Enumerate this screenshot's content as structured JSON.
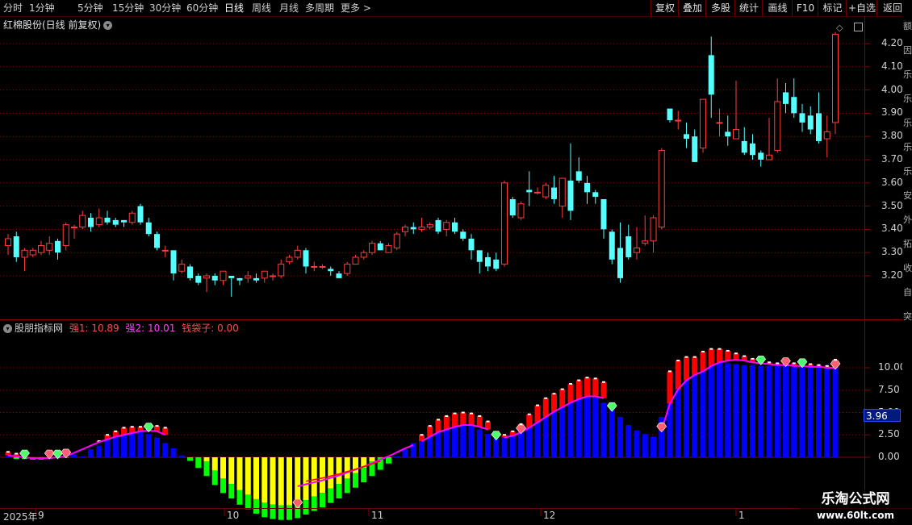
{
  "topbar": {
    "periods": [
      "分时",
      "1分钟",
      "5分钟",
      "15分钟",
      "30分钟",
      "60分钟",
      "日线",
      "周线",
      "月线",
      "多周期",
      "更多 >"
    ],
    "active_index": 6,
    "right_buttons": [
      "复权",
      "叠加",
      "多股",
      "统计",
      "画线",
      "F10",
      "标记",
      "+自选",
      "返回"
    ]
  },
  "main_panel": {
    "stock_title": "红棉股份(日线 前复权)",
    "y_ticks": [
      "4.20",
      "4.10",
      "4.00",
      "3.90",
      "3.80",
      "3.70",
      "3.60",
      "3.50",
      "3.40",
      "3.30",
      "3.20"
    ]
  },
  "indicator_panel": {
    "name": "股朋指标网",
    "line1_label": "强1: 10.89",
    "line2_label": "强2: 10.01",
    "line3_label": "钱袋子: 0.00",
    "y_ticks": [
      "10.00",
      "7.50",
      "5.00",
      "2.50",
      "0.00"
    ],
    "current_value": "3.96"
  },
  "x_axis": {
    "labels": [
      "2025年",
      "9",
      "10",
      "11",
      "12",
      "1"
    ]
  },
  "side_strip": [
    "额",
    "因",
    "乐",
    "乐",
    "乐",
    "乐",
    "乐",
    "安",
    "外",
    "拓",
    "收",
    "自",
    "突"
  ],
  "watermark": {
    "title": "乐淘公式网",
    "url": "www.60lt.com"
  },
  "colors": {
    "up": "#ff3c3c",
    "down": "#54ffff",
    "bar_blue": "#0000ff",
    "bar_red": "#ff0000",
    "bar_yellow": "#ffff00",
    "bar_green": "#00ff00",
    "line_magenta": "#ff00ff"
  },
  "chart_data": [
    {
      "type": "candlestick",
      "title": "红棉股份(日线 前复权)",
      "ylim": [
        3.1,
        4.25
      ],
      "candles": [
        [
          3.33,
          3.36,
          3.29,
          3.38
        ],
        [
          3.37,
          3.28,
          3.26,
          3.39
        ],
        [
          3.28,
          3.31,
          3.22,
          3.32
        ],
        [
          3.29,
          3.31,
          3.28,
          3.32
        ],
        [
          3.3,
          3.33,
          3.29,
          3.35
        ],
        [
          3.31,
          3.34,
          3.29,
          3.37
        ],
        [
          3.35,
          3.3,
          3.27,
          3.36
        ],
        [
          3.33,
          3.42,
          3.31,
          3.43
        ],
        [
          3.41,
          3.41,
          3.36,
          3.42
        ],
        [
          3.41,
          3.46,
          3.4,
          3.48
        ],
        [
          3.45,
          3.41,
          3.39,
          3.47
        ],
        [
          3.42,
          3.45,
          3.41,
          3.49
        ],
        [
          3.45,
          3.43,
          3.42,
          3.48
        ],
        [
          3.44,
          3.42,
          3.41,
          3.45
        ],
        [
          3.44,
          3.43,
          3.41,
          3.44
        ],
        [
          3.43,
          3.47,
          3.42,
          3.48
        ],
        [
          3.5,
          3.43,
          3.42,
          3.51
        ],
        [
          3.43,
          3.38,
          3.37,
          3.45
        ],
        [
          3.38,
          3.32,
          3.31,
          3.39
        ],
        [
          3.31,
          3.31,
          3.28,
          3.33
        ],
        [
          3.31,
          3.21,
          3.18,
          3.31
        ],
        [
          3.22,
          3.25,
          3.21,
          3.27
        ],
        [
          3.24,
          3.19,
          3.18,
          3.25
        ],
        [
          3.2,
          3.17,
          3.16,
          3.21
        ],
        [
          3.19,
          3.2,
          3.13,
          3.21
        ],
        [
          3.2,
          3.18,
          3.16,
          3.21
        ],
        [
          3.18,
          3.22,
          3.16,
          3.22
        ],
        [
          3.2,
          3.19,
          3.11,
          3.2
        ],
        [
          3.19,
          3.18,
          3.16,
          3.19
        ],
        [
          3.19,
          3.2,
          3.17,
          3.22
        ],
        [
          3.19,
          3.18,
          3.17,
          3.21
        ],
        [
          3.19,
          3.22,
          3.17,
          3.22
        ],
        [
          3.2,
          3.2,
          3.18,
          3.21
        ],
        [
          3.2,
          3.25,
          3.19,
          3.27
        ],
        [
          3.26,
          3.28,
          3.25,
          3.29
        ],
        [
          3.28,
          3.31,
          3.27,
          3.33
        ],
        [
          3.31,
          3.24,
          3.21,
          3.32
        ],
        [
          3.24,
          3.24,
          3.22,
          3.26
        ],
        [
          3.24,
          3.24,
          3.23,
          3.25
        ],
        [
          3.23,
          3.22,
          3.2,
          3.24
        ],
        [
          3.21,
          3.19,
          3.19,
          3.22
        ],
        [
          3.21,
          3.25,
          3.2,
          3.26
        ],
        [
          3.25,
          3.28,
          3.25,
          3.29
        ],
        [
          3.28,
          3.3,
          3.27,
          3.31
        ],
        [
          3.3,
          3.34,
          3.29,
          3.35
        ],
        [
          3.34,
          3.31,
          3.31,
          3.35
        ],
        [
          3.3,
          3.33,
          3.3,
          3.34
        ],
        [
          3.32,
          3.38,
          3.31,
          3.39
        ],
        [
          3.39,
          3.41,
          3.37,
          3.42
        ],
        [
          3.41,
          3.4,
          3.38,
          3.43
        ],
        [
          3.4,
          3.41,
          3.39,
          3.45
        ],
        [
          3.41,
          3.42,
          3.4,
          3.43
        ],
        [
          3.44,
          3.39,
          3.38,
          3.45
        ],
        [
          3.4,
          3.43,
          3.37,
          3.44
        ],
        [
          3.43,
          3.39,
          3.38,
          3.45
        ],
        [
          3.39,
          3.36,
          3.35,
          3.4
        ],
        [
          3.36,
          3.31,
          3.27,
          3.38
        ],
        [
          3.31,
          3.26,
          3.21,
          3.31
        ],
        [
          3.28,
          3.24,
          3.22,
          3.3
        ],
        [
          3.27,
          3.23,
          3.22,
          3.3
        ],
        [
          3.25,
          3.6,
          3.24,
          3.61
        ],
        [
          3.53,
          3.46,
          3.45,
          3.54
        ],
        [
          3.45,
          3.51,
          3.44,
          3.52
        ],
        [
          3.57,
          3.56,
          3.5,
          3.65
        ],
        [
          3.56,
          3.56,
          3.55,
          3.58
        ],
        [
          3.54,
          3.59,
          3.53,
          3.6
        ],
        [
          3.58,
          3.53,
          3.51,
          3.63
        ],
        [
          3.5,
          3.62,
          3.45,
          3.62
        ],
        [
          3.61,
          3.48,
          3.44,
          3.77
        ],
        [
          3.65,
          3.61,
          3.6,
          3.71
        ],
        [
          3.6,
          3.56,
          3.51,
          3.63
        ],
        [
          3.56,
          3.54,
          3.51,
          3.57
        ],
        [
          3.53,
          3.4,
          3.36,
          3.53
        ],
        [
          3.39,
          3.27,
          3.25,
          3.4
        ],
        [
          3.32,
          3.19,
          3.17,
          3.43
        ],
        [
          3.37,
          3.28,
          3.27,
          3.42
        ],
        [
          3.3,
          3.32,
          3.27,
          3.41
        ],
        [
          3.34,
          3.35,
          3.33,
          3.46
        ],
        [
          3.35,
          3.45,
          3.3,
          3.46
        ],
        [
          3.41,
          3.74,
          3.4,
          3.75
        ],
        [
          3.92,
          3.87,
          3.86,
          3.92
        ],
        [
          3.87,
          3.87,
          3.83,
          3.91
        ],
        [
          3.81,
          3.79,
          3.75,
          3.86
        ],
        [
          3.8,
          3.69,
          3.69,
          3.83
        ],
        [
          3.75,
          3.96,
          3.73,
          3.96
        ],
        [
          4.15,
          3.98,
          3.88,
          4.23
        ],
        [
          3.86,
          3.86,
          3.8,
          3.92
        ],
        [
          3.82,
          3.8,
          3.76,
          3.89
        ],
        [
          3.79,
          3.83,
          3.79,
          4.04
        ],
        [
          3.78,
          3.73,
          3.72,
          3.84
        ],
        [
          3.77,
          3.72,
          3.7,
          3.81
        ],
        [
          3.73,
          3.7,
          3.67,
          3.74
        ],
        [
          3.7,
          3.72,
          3.7,
          3.88
        ],
        [
          3.74,
          3.95,
          3.73,
          4.05
        ],
        [
          3.99,
          3.94,
          3.9,
          4.03
        ],
        [
          3.97,
          3.9,
          3.88,
          4.05
        ],
        [
          3.9,
          3.86,
          3.82,
          3.94
        ],
        [
          3.89,
          3.83,
          3.81,
          3.93
        ],
        [
          3.9,
          3.78,
          3.77,
          3.99
        ],
        [
          3.79,
          3.82,
          3.71,
          3.89
        ],
        [
          3.86,
          4.24,
          3.81,
          4.25
        ]
      ]
    },
    {
      "type": "bar",
      "title": "股朋指标网",
      "ylim": [
        -1.5,
        12.5
      ],
      "bars": [
        0.1,
        -0.2,
        -0.2,
        -0.25,
        -0.25,
        -0.2,
        -0.1,
        -0.05,
        0.3,
        0.1,
        0.9,
        1.3,
        1.9,
        2.3,
        2.6,
        2.8,
        2.9,
        2.6,
        2.2,
        1.6,
        1.0,
        0.2,
        -0.4,
        -1.2,
        -2.1,
        -3.1,
        -4.0,
        -4.6,
        -5.3,
        -5.8,
        -6.3,
        -6.7,
        -6.9,
        -7.0,
        -7.0,
        -6.8,
        -6.4,
        -6.0,
        -5.6,
        -5.1,
        -4.6,
        -4.0,
        -3.4,
        -2.8,
        -2.1,
        -1.4,
        -0.7,
        0.1,
        0.9,
        1.6,
        2.3,
        2.9,
        3.3,
        3.6,
        3.9,
        3.9,
        3.6,
        3.1,
        2.6,
        2.1,
        2.2,
        2.5,
        2.8,
        3.4,
        4.2,
        4.9,
        5.4,
        5.9,
        6.4,
        6.7,
        6.8,
        6.7,
        6.1,
        5.3,
        4.5,
        3.6,
        3.0,
        2.6,
        2.3,
        4.5,
        8.2,
        9.6,
        10.2,
        10.4,
        10.6,
        10.7,
        10.6,
        10.5,
        10.4,
        10.3,
        10.3,
        10.2,
        10.2,
        10.2,
        10.3,
        10.3,
        10.3,
        10.2,
        10.1,
        10.0,
        10.0
      ],
      "strong1": [
        0.6,
        0.4,
        0.2,
        0.0,
        0.0,
        0.0,
        0.0,
        0.0,
        0.0,
        0.0,
        1.2,
        1.8,
        2.5,
        2.9,
        3.3,
        3.4,
        3.4,
        3.5,
        3.5,
        3.3,
        0,
        0,
        0,
        0,
        0,
        0,
        0,
        0,
        0,
        0,
        0,
        0,
        0,
        0,
        0,
        0,
        0,
        0,
        0,
        0,
        0,
        0,
        0,
        0,
        0,
        0,
        0,
        0,
        0,
        0,
        2.5,
        3.5,
        4.2,
        4.6,
        4.9,
        5.0,
        4.9,
        4.6,
        4.0,
        0,
        2.5,
        2.9,
        3.7,
        4.8,
        5.8,
        6.6,
        7.1,
        7.6,
        8.2,
        8.6,
        8.9,
        8.8,
        8.4,
        0,
        0,
        0,
        0,
        0,
        0,
        3.8,
        9.6,
        10.8,
        11.2,
        11.2,
        11.8,
        12.1,
        12.1,
        11.9,
        11.6,
        11.3,
        11.0,
        10.7,
        10.6,
        10.5,
        10.5,
        10.5,
        10.5,
        10.4,
        10.3,
        10.2,
        10.9
      ],
      "strong2": [
        0.2,
        0.1,
        0.0,
        -0.1,
        -0.1,
        -0.1,
        0.0,
        0.1,
        0.5,
        0.9,
        1.3,
        1.7,
        2.0,
        2.3,
        2.5,
        2.7,
        2.9,
        3.0,
        2.9,
        2.5,
        0,
        0,
        0,
        0,
        0,
        0,
        0,
        0,
        0,
        0,
        0,
        0,
        0,
        0,
        0,
        0,
        0,
        0,
        0,
        0,
        0,
        0,
        0,
        0,
        0,
        0,
        0,
        0,
        0,
        0,
        1.8,
        2.3,
        2.8,
        3.1,
        3.4,
        3.6,
        3.6,
        3.4,
        3.1,
        0,
        2.2,
        2.4,
        2.8,
        3.3,
        3.9,
        4.5,
        5.1,
        5.6,
        6.1,
        6.5,
        6.8,
        6.8,
        6.6,
        0,
        0,
        0,
        0,
        0,
        0,
        3.0,
        6.0,
        7.6,
        8.6,
        9.2,
        9.6,
        10.2,
        10.6,
        10.8,
        10.9,
        10.8,
        10.6,
        10.5,
        10.4,
        10.3,
        10.3,
        10.2,
        10.2,
        10.1,
        10.1,
        10.0,
        10.0
      ]
    }
  ]
}
